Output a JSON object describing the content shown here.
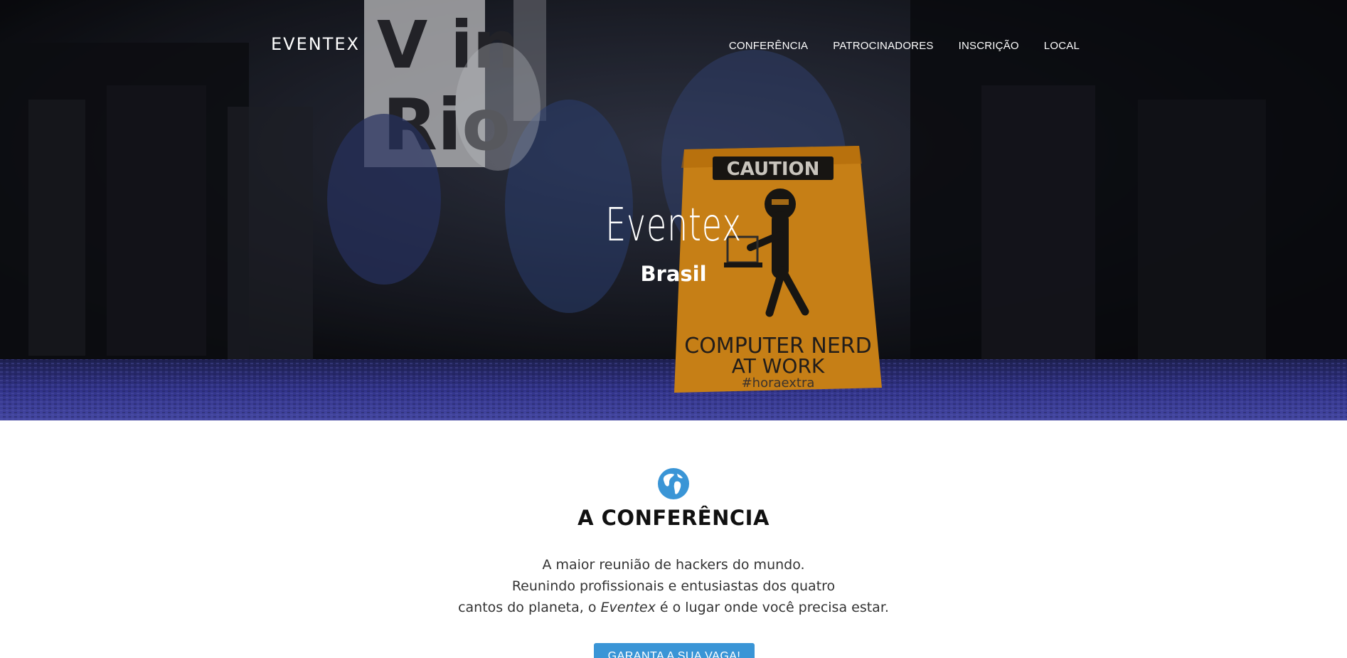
{
  "header": {
    "brand": "EVENTEX",
    "nav": [
      {
        "label": "CONFERÊNCIA"
      },
      {
        "label": "PATROCINADORES"
      },
      {
        "label": "INSCRIÇÃO"
      },
      {
        "label": "LOCAL"
      }
    ]
  },
  "hero": {
    "title": "Eventex",
    "subtitle": "Brasil",
    "sign": {
      "caution": "CAUTION",
      "line1": "COMPUTER NERD",
      "line2": "AT WORK",
      "tag": "#horaextra"
    },
    "banner_text": {
      "line1": "V in",
      "line2": "Rio"
    }
  },
  "conference": {
    "icon": "globe-icon",
    "title": "A CONFERÊNCIA",
    "line1": "A maior reunião de hackers do mundo.",
    "line2": "Reunindo profissionais e entusiastas dos quatro",
    "line3_before": "cantos do planeta, o ",
    "line3_em": "Eventex",
    "line3_after": " é o lugar onde você precisa estar.",
    "cta_label": "GARANTA A SUA VAGA!"
  },
  "colors": {
    "accent": "#3a95d6",
    "sign_orange": "#f29b1b",
    "carpet_blue": "#3d3fa8"
  }
}
